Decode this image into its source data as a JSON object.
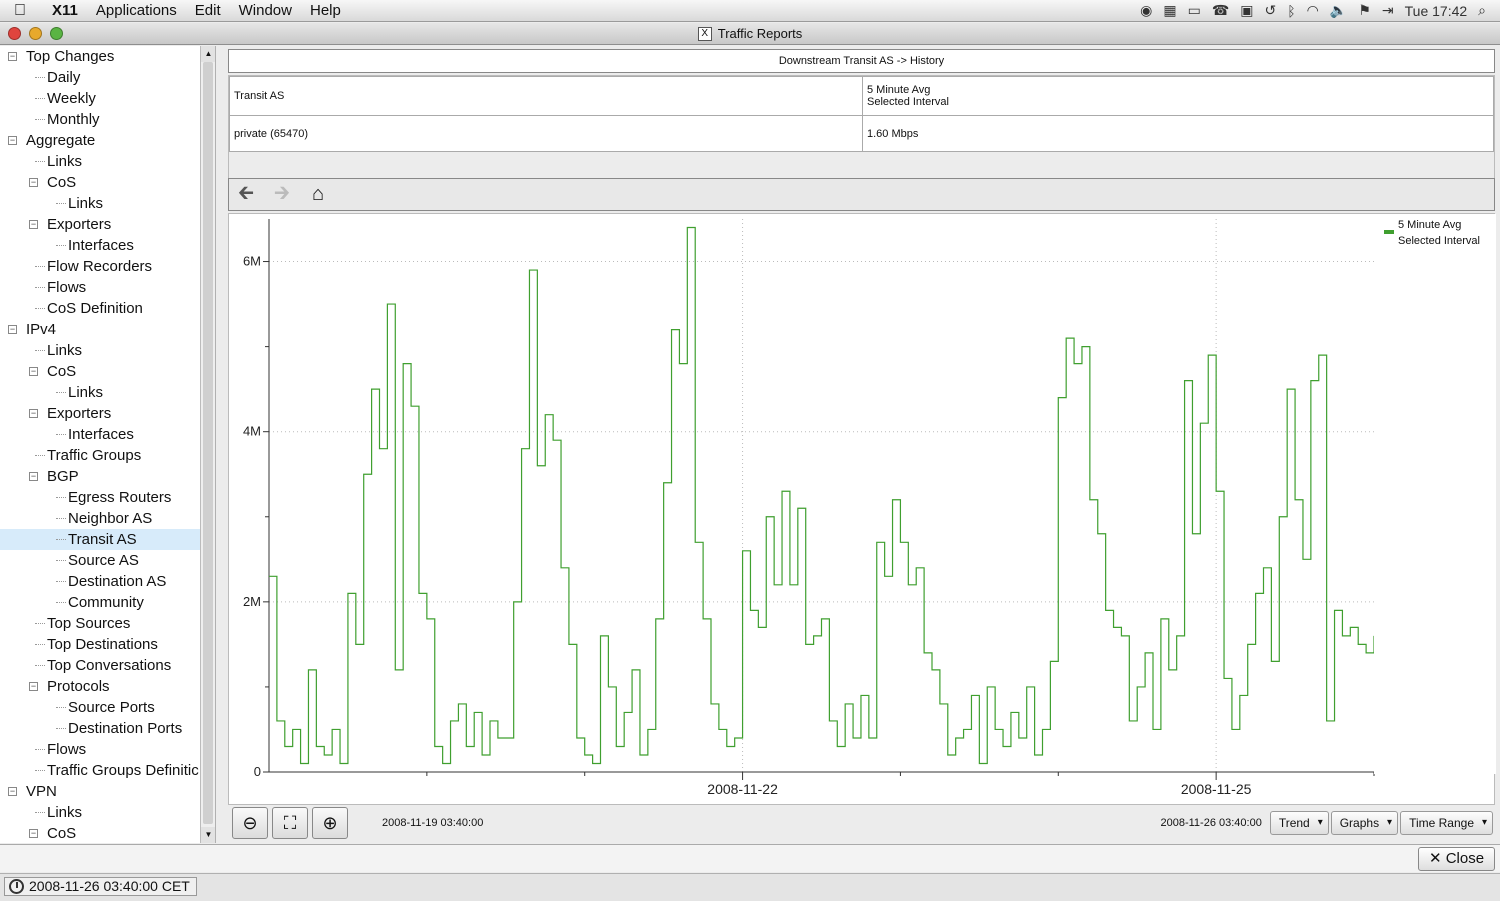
{
  "menubar": {
    "app": "X11",
    "items": [
      "Applications",
      "Edit",
      "Window",
      "Help"
    ],
    "clock": "Tue 17:42"
  },
  "window": {
    "title": "Traffic Reports"
  },
  "tree": [
    {
      "label": "Top Changes",
      "level": 0,
      "expanded": true
    },
    {
      "label": "Daily",
      "level": 1
    },
    {
      "label": "Weekly",
      "level": 1
    },
    {
      "label": "Monthly",
      "level": 1
    },
    {
      "label": "Aggregate",
      "level": 0,
      "expanded": true
    },
    {
      "label": "Links",
      "level": 1
    },
    {
      "label": "CoS",
      "level": 1,
      "expanded": true
    },
    {
      "label": "Links",
      "level": 2
    },
    {
      "label": "Exporters",
      "level": 1,
      "expanded": true
    },
    {
      "label": "Interfaces",
      "level": 2
    },
    {
      "label": "Flow Recorders",
      "level": 1
    },
    {
      "label": "Flows",
      "level": 1
    },
    {
      "label": "CoS Definition",
      "level": 1
    },
    {
      "label": "IPv4",
      "level": 0,
      "expanded": true
    },
    {
      "label": "Links",
      "level": 1
    },
    {
      "label": "CoS",
      "level": 1,
      "expanded": true
    },
    {
      "label": "Links",
      "level": 2
    },
    {
      "label": "Exporters",
      "level": 1,
      "expanded": true
    },
    {
      "label": "Interfaces",
      "level": 2
    },
    {
      "label": "Traffic Groups",
      "level": 1
    },
    {
      "label": "BGP",
      "level": 1,
      "expanded": true
    },
    {
      "label": "Egress Routers",
      "level": 2
    },
    {
      "label": "Neighbor AS",
      "level": 2
    },
    {
      "label": "Transit AS",
      "level": 2,
      "selected": true
    },
    {
      "label": "Source AS",
      "level": 2
    },
    {
      "label": "Destination AS",
      "level": 2
    },
    {
      "label": "Community",
      "level": 2
    },
    {
      "label": "Top Sources",
      "level": 1
    },
    {
      "label": "Top Destinations",
      "level": 1
    },
    {
      "label": "Top Conversations",
      "level": 1
    },
    {
      "label": "Protocols",
      "level": 1,
      "expanded": true
    },
    {
      "label": "Source Ports",
      "level": 2
    },
    {
      "label": "Destination Ports",
      "level": 2
    },
    {
      "label": "Flows",
      "level": 1
    },
    {
      "label": "Traffic Groups Definitic",
      "level": 1
    },
    {
      "label": "VPN",
      "level": 0,
      "expanded": true
    },
    {
      "label": "Links",
      "level": 1
    },
    {
      "label": "CoS",
      "level": 1,
      "expanded": true
    }
  ],
  "panel": {
    "header": "Downstream Transit AS -> History",
    "table": {
      "col1_header": "Transit AS",
      "col2_header_line1": "5 Minute Avg",
      "col2_header_line2": "Selected Interval",
      "row_name": "private (65470)",
      "row_value": "1.60 Mbps"
    }
  },
  "chart_data": {
    "type": "line",
    "legend": [
      "5 Minute Avg",
      "Selected Interval"
    ],
    "legend_position": "top-right",
    "series_color": "#3f9f2f",
    "y_ticks": [
      {
        "value": 0,
        "label": "0"
      },
      {
        "value": 2,
        "label": "2M"
      },
      {
        "value": 4,
        "label": "4M"
      },
      {
        "value": 6,
        "label": "6M"
      }
    ],
    "ylim": [
      0,
      6.5
    ],
    "x_ticks": [
      {
        "day": 3.0,
        "label": "2008-11-22"
      },
      {
        "day": 6.0,
        "label": "2008-11-25"
      }
    ],
    "xlim": [
      0,
      7
    ],
    "x": [
      0,
      0.05,
      0.1,
      0.15,
      0.2,
      0.25,
      0.3,
      0.35,
      0.4,
      0.45,
      0.5,
      0.55,
      0.6,
      0.65,
      0.7,
      0.75,
      0.8,
      0.85,
      0.9,
      0.95,
      1.0,
      1.05,
      1.1,
      1.15,
      1.2,
      1.25,
      1.3,
      1.35,
      1.4,
      1.45,
      1.5,
      1.55,
      1.6,
      1.65,
      1.7,
      1.75,
      1.8,
      1.85,
      1.9,
      1.95,
      2.0,
      2.05,
      2.1,
      2.15,
      2.2,
      2.25,
      2.3,
      2.35,
      2.4,
      2.45,
      2.5,
      2.55,
      2.6,
      2.65,
      2.7,
      2.75,
      2.8,
      2.85,
      2.9,
      2.95,
      3.0,
      3.05,
      3.1,
      3.15,
      3.2,
      3.25,
      3.3,
      3.35,
      3.4,
      3.45,
      3.5,
      3.55,
      3.6,
      3.65,
      3.7,
      3.75,
      3.8,
      3.85,
      3.9,
      3.95,
      4.0,
      4.05,
      4.1,
      4.15,
      4.2,
      4.25,
      4.3,
      4.35,
      4.4,
      4.45,
      4.5,
      4.55,
      4.6,
      4.65,
      4.7,
      4.75,
      4.8,
      4.85,
      4.9,
      4.95,
      5.0,
      5.05,
      5.1,
      5.15,
      5.2,
      5.25,
      5.3,
      5.35,
      5.4,
      5.45,
      5.5,
      5.55,
      5.6,
      5.65,
      5.7,
      5.75,
      5.8,
      5.85,
      5.9,
      5.95,
      6.0,
      6.05,
      6.1,
      6.15,
      6.2,
      6.25,
      6.3,
      6.35,
      6.4,
      6.45,
      6.5,
      6.55,
      6.6,
      6.65,
      6.7,
      6.75,
      6.8,
      6.85,
      6.9,
      6.95,
      7.0
    ],
    "y": [
      2.3,
      0.6,
      0.3,
      0.5,
      0.1,
      1.2,
      0.3,
      0.2,
      0.5,
      0.1,
      2.1,
      1.5,
      3.5,
      4.5,
      3.8,
      5.5,
      1.2,
      4.8,
      4.3,
      2.1,
      1.8,
      0.3,
      0.1,
      0.6,
      0.8,
      0.3,
      0.7,
      0.2,
      0.6,
      0.4,
      0.4,
      2.0,
      3.8,
      5.9,
      3.6,
      4.2,
      3.9,
      2.4,
      1.5,
      0.4,
      0.2,
      0.1,
      1.6,
      1.0,
      0.3,
      0.7,
      1.2,
      0.2,
      0.5,
      1.8,
      3.4,
      5.2,
      4.8,
      6.4,
      2.7,
      1.8,
      0.8,
      0.5,
      0.3,
      0.4,
      2.6,
      1.9,
      1.7,
      3.0,
      2.2,
      3.3,
      2.2,
      3.1,
      1.5,
      1.6,
      1.8,
      0.6,
      0.3,
      0.8,
      0.4,
      0.9,
      0.4,
      2.7,
      2.3,
      3.2,
      2.7,
      2.2,
      2.4,
      1.4,
      1.2,
      0.8,
      0.2,
      0.4,
      0.5,
      0.9,
      0.1,
      1.0,
      0.5,
      0.3,
      0.7,
      0.4,
      1.0,
      0.2,
      0.5,
      1.3,
      4.4,
      5.1,
      4.8,
      5.0,
      3.2,
      2.8,
      1.9,
      1.7,
      1.6,
      0.6,
      1.0,
      1.4,
      0.5,
      1.8,
      1.2,
      1.6,
      4.6,
      2.8,
      4.1,
      4.9,
      3.3,
      1.1,
      0.5,
      0.9,
      1.5,
      2.1,
      2.4,
      1.3,
      3.0,
      4.5,
      3.2,
      2.5,
      4.6,
      4.9,
      0.6,
      1.9,
      1.6,
      1.7,
      1.5,
      1.4,
      1.6
    ],
    "start_label": "2008-11-19 03:40:00",
    "end_label": "2008-11-26 03:40:00"
  },
  "controls": {
    "trend": "Trend",
    "graphs": "Graphs",
    "time_range": "Time Range"
  },
  "close_label": "Close",
  "status": "2008-11-26 03:40:00 CET"
}
